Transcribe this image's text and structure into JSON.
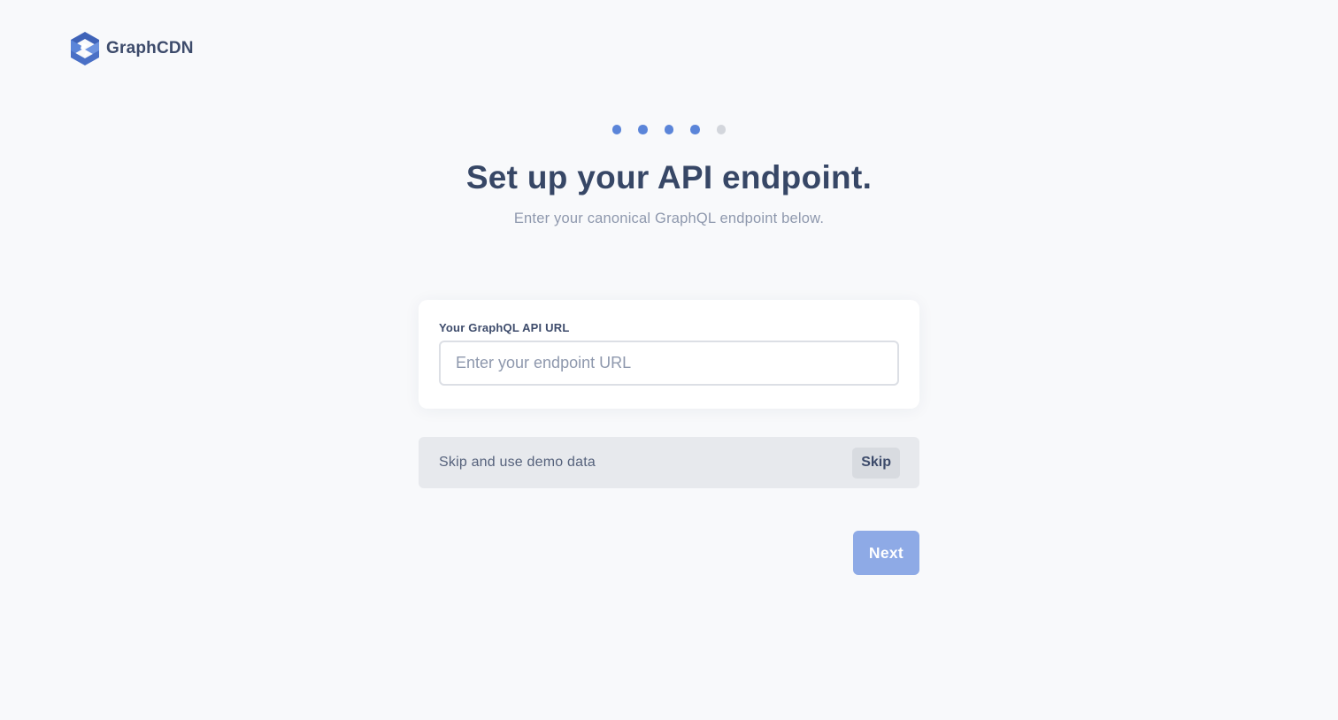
{
  "brand": {
    "name": "GraphCDN",
    "logo_icon": "graphcdn-logo-icon",
    "logo_colors": [
      "#5b85d9",
      "#3f63b8"
    ]
  },
  "stepper": {
    "total": 5,
    "completed": 4,
    "active_color": "#5b85d9",
    "inactive_color": "#d3d6dc"
  },
  "header": {
    "title": "Set up your API endpoint.",
    "subtitle": "Enter your canonical GraphQL endpoint below."
  },
  "endpoint_form": {
    "label": "Your GraphQL API URL",
    "value": "",
    "placeholder": "Enter your endpoint URL"
  },
  "skip_section": {
    "text": "Skip and use demo data",
    "button_label": "Skip"
  },
  "actions": {
    "next_label": "Next",
    "next_color": "#8eaae6"
  }
}
